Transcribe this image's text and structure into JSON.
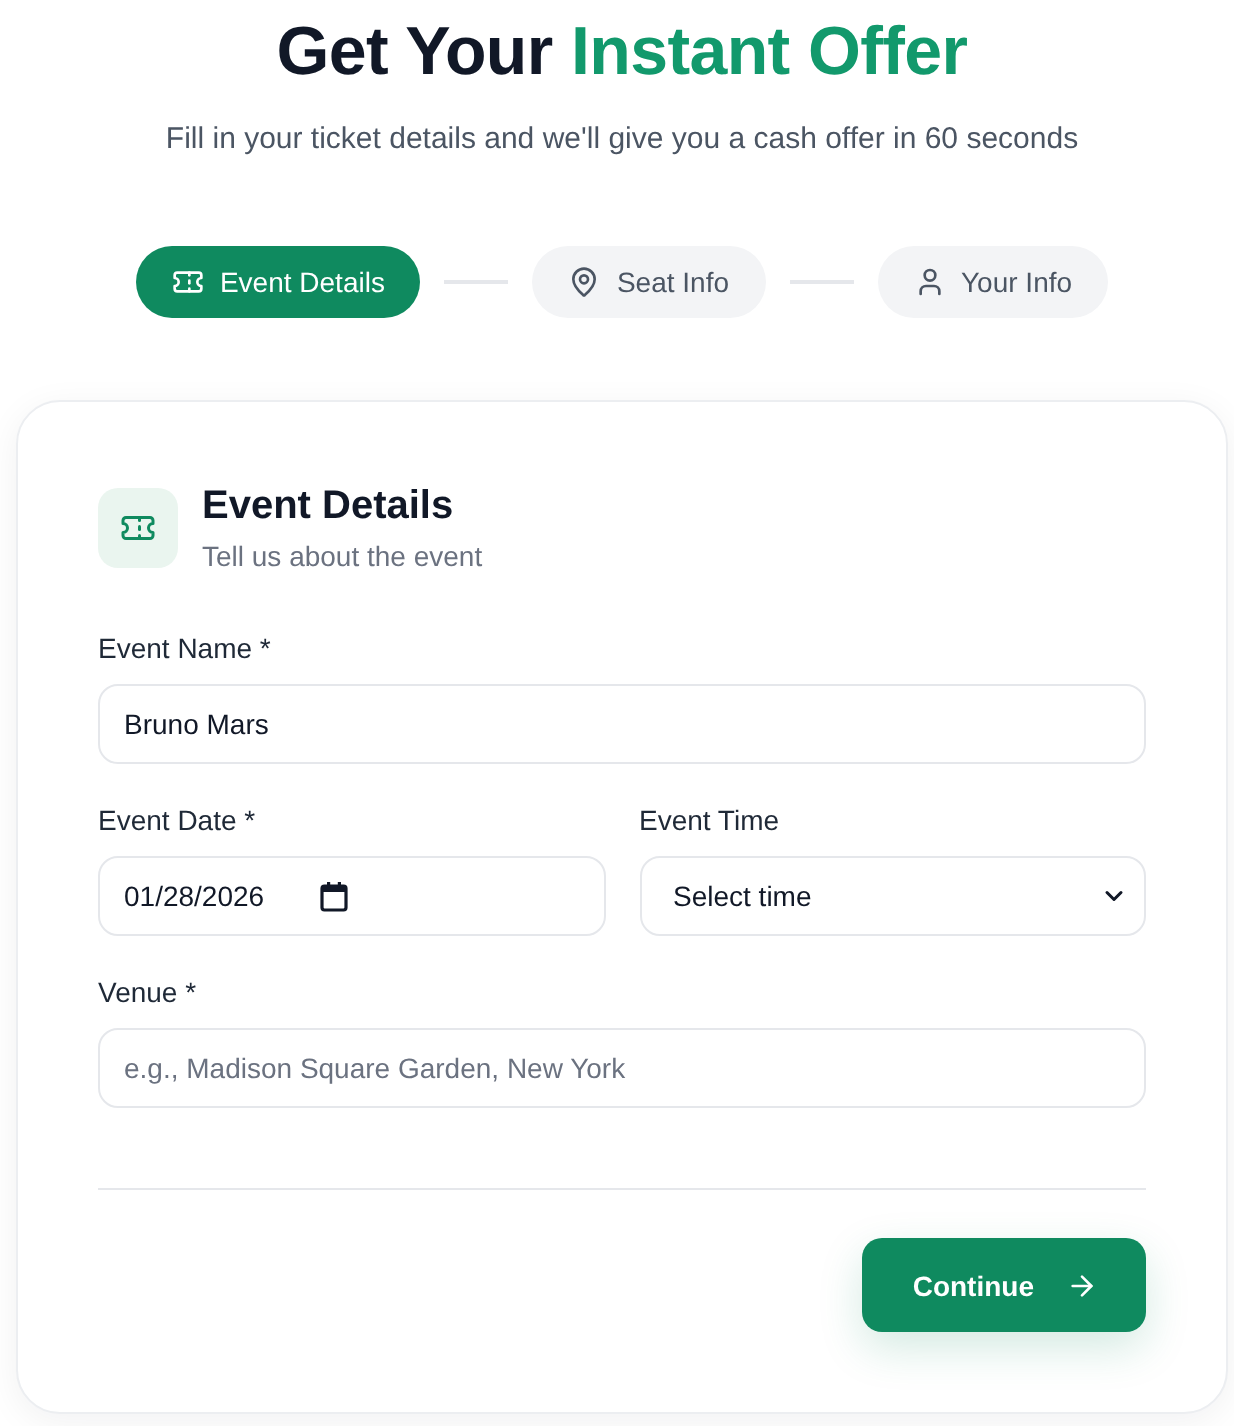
{
  "header": {
    "title": {
      "lead": "Get Your",
      "highlight": "Instant Offer"
    },
    "subtitle": "Fill in your ticket details and we'll give you a cash offer in 60 seconds"
  },
  "steps": [
    {
      "label": "Event Details",
      "selected": true
    },
    {
      "label": "Seat Info",
      "selected": false
    },
    {
      "label": "Your Info",
      "selected": false
    }
  ],
  "card": {
    "title": "Event Details",
    "subtitle": "Tell us about the event",
    "rows": [
      {
        "fields": [
          {
            "kind": "text",
            "label": "Event Name *",
            "value": "Bruno Mars"
          }
        ]
      },
      {
        "fields": [
          {
            "kind": "date",
            "label": "Event Date *",
            "value": "01/28/2026"
          },
          {
            "kind": "select",
            "label": "Event Time",
            "value": "Select time"
          }
        ]
      },
      {
        "fields": [
          {
            "kind": "text",
            "label": "Venue *",
            "placeholder": "e.g., Madison Square Garden, New York"
          }
        ]
      }
    ],
    "button": "Continue"
  }
}
